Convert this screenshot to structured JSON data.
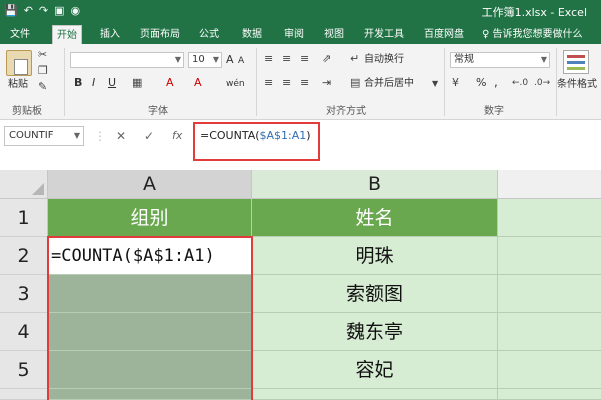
{
  "title_bar": {
    "title": "工作簿1.xlsx - Excel",
    "qat_icons": [
      "save-icon",
      "undo-icon",
      "redo-icon",
      "new-file-icon",
      "camera-icon"
    ]
  },
  "tabs": [
    {
      "label": "文件"
    },
    {
      "label": "开始"
    },
    {
      "label": "插入"
    },
    {
      "label": "页面布局"
    },
    {
      "label": "公式"
    },
    {
      "label": "数据"
    },
    {
      "label": "审阅"
    },
    {
      "label": "视图"
    },
    {
      "label": "开发工具"
    },
    {
      "label": "百度网盘"
    }
  ],
  "tell_me": "♀ 告诉我您想要做什么",
  "ribbon": {
    "clipboard": {
      "paste_label": "粘贴",
      "group_label": "剪贴板"
    },
    "font": {
      "name_value": "",
      "size_value": "10",
      "group_label": "字体",
      "bold": "B",
      "italic": "I",
      "underline": "U",
      "grow": "A",
      "shrink": "A",
      "font_color": "A",
      "highlight": "A",
      "wen": "wén"
    },
    "alignment": {
      "wrap_text": "自动换行",
      "merge_center": "合并后居中",
      "group_label": "对齐方式"
    },
    "number": {
      "format_value": "常规",
      "percent": "%",
      "comma": ",",
      "group_label": "数字"
    },
    "styles": {
      "conditional_format": "条件格式"
    }
  },
  "formula_bar": {
    "name_box": "COUNTIF",
    "cancel": "✕",
    "enter": "✓",
    "fx": "fx",
    "formula_prefix": "=COUNTA(",
    "formula_ref": "$A$1:A1",
    "formula_suffix": ")"
  },
  "grid": {
    "columns": [
      "A",
      "B"
    ],
    "rows": [
      "1",
      "2",
      "3",
      "4",
      "5"
    ],
    "cells": {
      "A1": "组别",
      "B1": "姓名",
      "A2": "=COUNTA($A$1:A1)",
      "B2": "明珠",
      "A3": "",
      "B3": "索额图",
      "A4": "",
      "B4": "魏东亭",
      "A5": "",
      "B5": "容妃"
    }
  },
  "colors": {
    "excel_green": "#217346",
    "header_green": "#6aa84f",
    "light_green": "#d6ecd3",
    "selection_gray": "#9db49a",
    "highlight_red": "#e23b3b"
  }
}
